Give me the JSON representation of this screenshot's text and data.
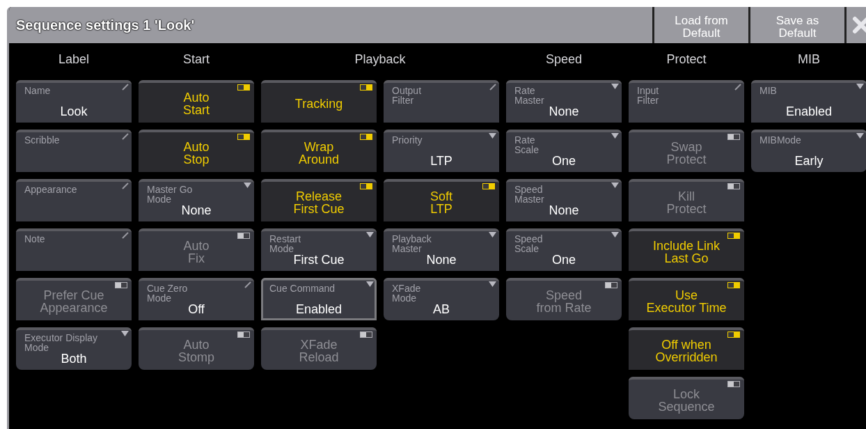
{
  "window": {
    "title": "Sequence settings 1 'Look'",
    "buttons": [
      "Load from\nDefault",
      "Save as\nDefault"
    ]
  },
  "sections": [
    {
      "title": "Label",
      "columns": [
        [
          {
            "kind": "edit",
            "label": "Name",
            "value": "Look",
            "selected": false
          },
          {
            "kind": "edit",
            "label": "Scribble",
            "selected": false
          },
          {
            "kind": "edit",
            "label": "Appearance",
            "selected": false
          },
          {
            "kind": "edit",
            "label": "Note",
            "selected": false
          },
          {
            "kind": "toggle",
            "text": "Prefer Cue\nAppearance",
            "on": false,
            "selected": false
          },
          {
            "kind": "dropdown",
            "label": "Executor Display\nMode",
            "value": "Both",
            "selected": false
          }
        ]
      ]
    },
    {
      "title": "Start",
      "columns": [
        [
          {
            "kind": "toggle",
            "text": "Auto\nStart",
            "on": true,
            "selected": false
          },
          {
            "kind": "toggle",
            "text": "Auto\nStop",
            "on": true,
            "selected": false
          },
          {
            "kind": "dropdown",
            "label": "Master Go\nMode",
            "value": "None",
            "selected": false
          },
          {
            "kind": "toggle",
            "text": "Auto\nFix",
            "on": false,
            "selected": false
          },
          {
            "kind": "edit",
            "label": "Cue Zero\nMode",
            "value": "Off",
            "selected": false
          },
          {
            "kind": "toggle",
            "text": "Auto\nStomp",
            "on": false,
            "selected": false
          }
        ]
      ]
    },
    {
      "title": "Playback",
      "columns": [
        [
          {
            "kind": "toggle",
            "text": "Tracking",
            "on": true,
            "selected": false
          },
          {
            "kind": "toggle",
            "text": "Wrap\nAround",
            "on": true,
            "selected": false
          },
          {
            "kind": "toggle",
            "text": "Release\nFirst Cue",
            "on": true,
            "selected": false
          },
          {
            "kind": "dropdown",
            "label": "Restart\nMode",
            "value": "First Cue",
            "selected": false
          },
          {
            "kind": "dropdown",
            "label": "Cue Command",
            "value": "Enabled",
            "selected": true
          },
          {
            "kind": "toggle",
            "text": "XFade\nReload",
            "on": false,
            "selected": false
          }
        ],
        [
          {
            "kind": "edit",
            "label": "Output\nFilter",
            "selected": false
          },
          {
            "kind": "dropdown",
            "label": "Priority",
            "value": "LTP",
            "selected": false
          },
          {
            "kind": "toggle",
            "text": "Soft\nLTP",
            "on": true,
            "selected": false
          },
          {
            "kind": "dropdown",
            "label": "Playback\nMaster",
            "value": "None",
            "selected": false
          },
          {
            "kind": "dropdown",
            "label": "XFade\nMode",
            "value": "AB",
            "selected": false
          }
        ]
      ]
    },
    {
      "title": "Speed",
      "columns": [
        [
          {
            "kind": "dropdown",
            "label": "Rate\nMaster",
            "value": "None",
            "selected": false
          },
          {
            "kind": "dropdown",
            "label": "Rate\nScale",
            "value": "One",
            "selected": false
          },
          {
            "kind": "dropdown",
            "label": "Speed\nMaster",
            "value": "None",
            "selected": false
          },
          {
            "kind": "dropdown",
            "label": "Speed\nScale",
            "value": "One",
            "selected": false
          },
          {
            "kind": "toggle",
            "text": "Speed\nfrom Rate",
            "on": false,
            "selected": false
          }
        ]
      ]
    },
    {
      "title": "Protect",
      "columns": [
        [
          {
            "kind": "edit",
            "label": "Input\nFilter",
            "selected": false
          },
          {
            "kind": "toggle",
            "text": "Swap\nProtect",
            "on": false,
            "selected": false
          },
          {
            "kind": "toggle",
            "text": "Kill\nProtect",
            "on": false,
            "selected": false
          },
          {
            "kind": "toggle",
            "text": "Include Link\nLast Go",
            "on": true,
            "selected": false
          },
          {
            "kind": "toggle",
            "text": "Use\nExecutor Time",
            "on": true,
            "selected": false
          },
          {
            "kind": "toggle",
            "text": "Off when\nOverridden",
            "on": true,
            "selected": false
          },
          {
            "kind": "toggle",
            "text": "Lock\nSequence",
            "on": false,
            "selected": false
          }
        ]
      ]
    },
    {
      "title": "MIB",
      "columns": [
        [
          {
            "kind": "dropdown",
            "label": "MIB",
            "value": "Enabled",
            "selected": false
          },
          {
            "kind": "dropdown",
            "label": "MIBMode",
            "value": "Early",
            "selected": false
          }
        ]
      ]
    }
  ]
}
